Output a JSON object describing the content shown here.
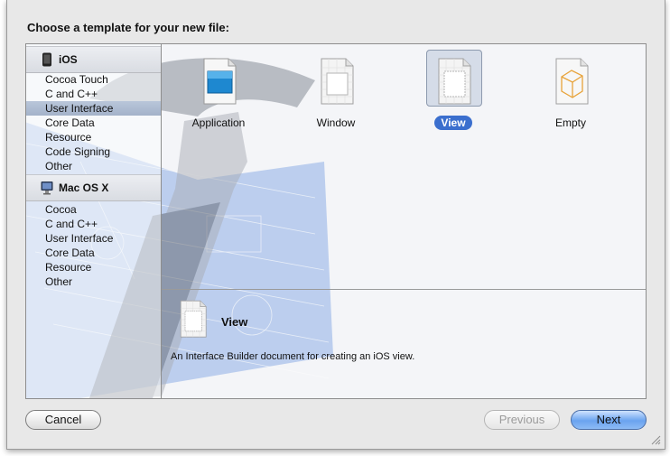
{
  "dialog": {
    "title": "Choose a template for your new file:"
  },
  "sidebar": {
    "groups": [
      {
        "label": "iOS",
        "icon": "iphone-icon",
        "items": [
          "Cocoa Touch",
          "C and C++",
          "User Interface",
          "Core Data",
          "Resource",
          "Code Signing",
          "Other"
        ],
        "selected": "User Interface"
      },
      {
        "label": "Mac OS X",
        "icon": "mac-icon",
        "items": [
          "Cocoa",
          "C and C++",
          "User Interface",
          "Core Data",
          "Resource",
          "Other"
        ]
      }
    ]
  },
  "templates": [
    {
      "label": "Application",
      "icon": "application-template-icon"
    },
    {
      "label": "Window",
      "icon": "window-template-icon"
    },
    {
      "label": "View",
      "icon": "view-template-icon",
      "selected": true
    },
    {
      "label": "Empty",
      "icon": "empty-template-icon"
    }
  ],
  "detail": {
    "name": "View",
    "description": "An Interface Builder document for creating an iOS view."
  },
  "buttons": {
    "cancel": "Cancel",
    "previous": "Previous",
    "next": "Next"
  },
  "colors": {
    "selection": "#3b6fce",
    "sidebar_selection": "#a3b2c9",
    "backdrop_blueprint": "#8fb0e6"
  }
}
